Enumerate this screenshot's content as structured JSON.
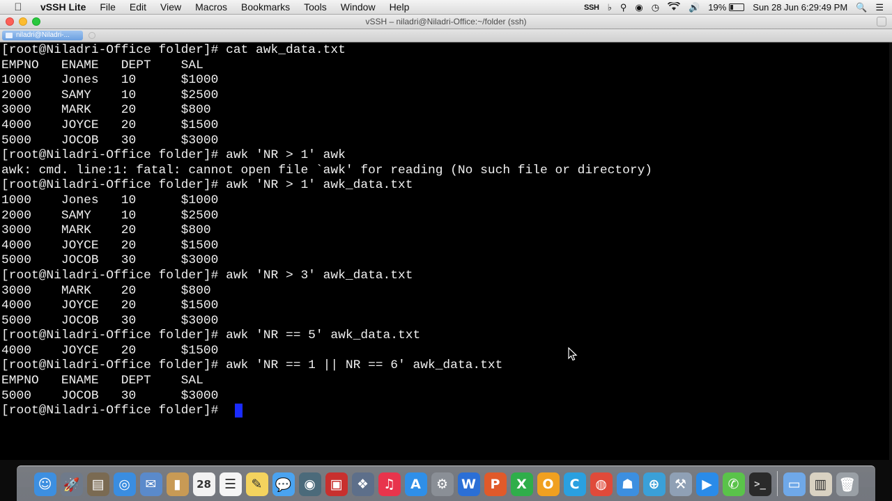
{
  "menubar": {
    "apple_glyph": "",
    "app_name": "vSSH Lite",
    "menus": [
      "File",
      "Edit",
      "View",
      "Macros",
      "Bookmarks",
      "Tools",
      "Window",
      "Help"
    ],
    "status": {
      "ssh_label": "SSH",
      "battery_percent": "19%",
      "battery_level": 0.19,
      "datetime": "Sun 28 Jun   6:29:49 PM"
    }
  },
  "window": {
    "title": "vSSH – niladri@Niladri-Office:~/folder (ssh)",
    "tab_label": "niladri@Niladri-..."
  },
  "terminal": {
    "lines": [
      "[root@Niladri-Office folder]# cat awk_data.txt",
      "EMPNO   ENAME   DEPT    SAL",
      "1000    Jones   10      $1000",
      "2000    SAMY    10      $2500",
      "3000    MARK    20      $800",
      "4000    JOYCE   20      $1500",
      "5000    JOCOB   30      $3000",
      "[root@Niladri-Office folder]# awk 'NR > 1' awk",
      "awk: cmd. line:1: fatal: cannot open file `awk' for reading (No such file or directory)",
      "[root@Niladri-Office folder]# awk 'NR > 1' awk_data.txt",
      "1000    Jones   10      $1000",
      "2000    SAMY    10      $2500",
      "3000    MARK    20      $800",
      "4000    JOYCE   20      $1500",
      "5000    JOCOB   30      $3000",
      "[root@Niladri-Office folder]# awk 'NR > 3' awk_data.txt",
      "3000    MARK    20      $800",
      "4000    JOYCE   20      $1500",
      "5000    JOCOB   30      $3000",
      "[root@Niladri-Office folder]# awk 'NR == 5' awk_data.txt",
      "4000    JOYCE   20      $1500",
      "[root@Niladri-Office folder]# awk 'NR == 1 || NR == 6' awk_data.txt",
      "EMPNO   ENAME   DEPT    SAL",
      "5000    JOCOB   30      $3000",
      "[root@Niladri-Office folder]# "
    ],
    "cursor_color": "#1a2bff"
  },
  "dock": {
    "apps": [
      {
        "name": "finder-icon",
        "glyph": "☺",
        "color": "#3d8fe0"
      },
      {
        "name": "launchpad-icon",
        "glyph": "🚀",
        "color": "#6f7a8a"
      },
      {
        "name": "system-utility-icon",
        "glyph": "▤",
        "color": "#7a6a52"
      },
      {
        "name": "safari-icon",
        "glyph": "◎",
        "color": "#3a8de0"
      },
      {
        "name": "mail-stamp-icon",
        "glyph": "✉",
        "color": "#5a8acb"
      },
      {
        "name": "contacts-icon",
        "glyph": "▮",
        "color": "#c89a55"
      },
      {
        "name": "calendar-icon",
        "glyph": "28",
        "color": "#f2f2f2"
      },
      {
        "name": "reminders-icon",
        "glyph": "☰",
        "color": "#f5f5f5"
      },
      {
        "name": "notes-icon",
        "glyph": "✎",
        "color": "#f4d35e"
      },
      {
        "name": "messages-icon",
        "glyph": "💬",
        "color": "#4aa3f0"
      },
      {
        "name": "facetime-icon",
        "glyph": "◉",
        "color": "#4b6a7a"
      },
      {
        "name": "photo-booth-icon",
        "glyph": "▣",
        "color": "#c8302e"
      },
      {
        "name": "iphoto-icon",
        "glyph": "❖",
        "color": "#5d6f8a"
      },
      {
        "name": "itunes-icon",
        "glyph": "♫",
        "color": "#e8344c"
      },
      {
        "name": "app-store-icon",
        "glyph": "A",
        "color": "#2f8fe8"
      },
      {
        "name": "system-preferences-icon",
        "glyph": "⚙",
        "color": "#8a8f96"
      },
      {
        "name": "word-icon",
        "glyph": "W",
        "color": "#2b6fd6"
      },
      {
        "name": "powerpoint-icon",
        "glyph": "P",
        "color": "#e05a2a"
      },
      {
        "name": "excel-icon",
        "glyph": "X",
        "color": "#2fae4a"
      },
      {
        "name": "outlook-icon",
        "glyph": "O",
        "color": "#f0a020"
      },
      {
        "name": "lync-icon",
        "glyph": "C",
        "color": "#2aa0e0"
      },
      {
        "name": "chrome-icon",
        "glyph": "◍",
        "color": "#e04a3a"
      },
      {
        "name": "people-icon",
        "glyph": "☗",
        "color": "#3c8fe0"
      },
      {
        "name": "network-globe-icon",
        "glyph": "⊕",
        "color": "#3aa0d8"
      },
      {
        "name": "xcode-icon",
        "glyph": "⚒",
        "color": "#8fa0b5"
      },
      {
        "name": "video-camera-icon",
        "glyph": "▶",
        "color": "#2a8be8"
      },
      {
        "name": "chat-bubble-icon",
        "glyph": "✆",
        "color": "#5ac34a"
      },
      {
        "name": "vssh-terminal-icon",
        "glyph": ">_",
        "color": "#2a2a2a"
      }
    ],
    "docs": [
      {
        "name": "applications-folder-icon",
        "glyph": "▭",
        "color": "#6fa8e8"
      },
      {
        "name": "documents-stack-icon",
        "glyph": "▥",
        "color": "#d9d2c2"
      },
      {
        "name": "trash-icon",
        "glyph": "🗑",
        "color": "#9aa0a6"
      }
    ]
  }
}
